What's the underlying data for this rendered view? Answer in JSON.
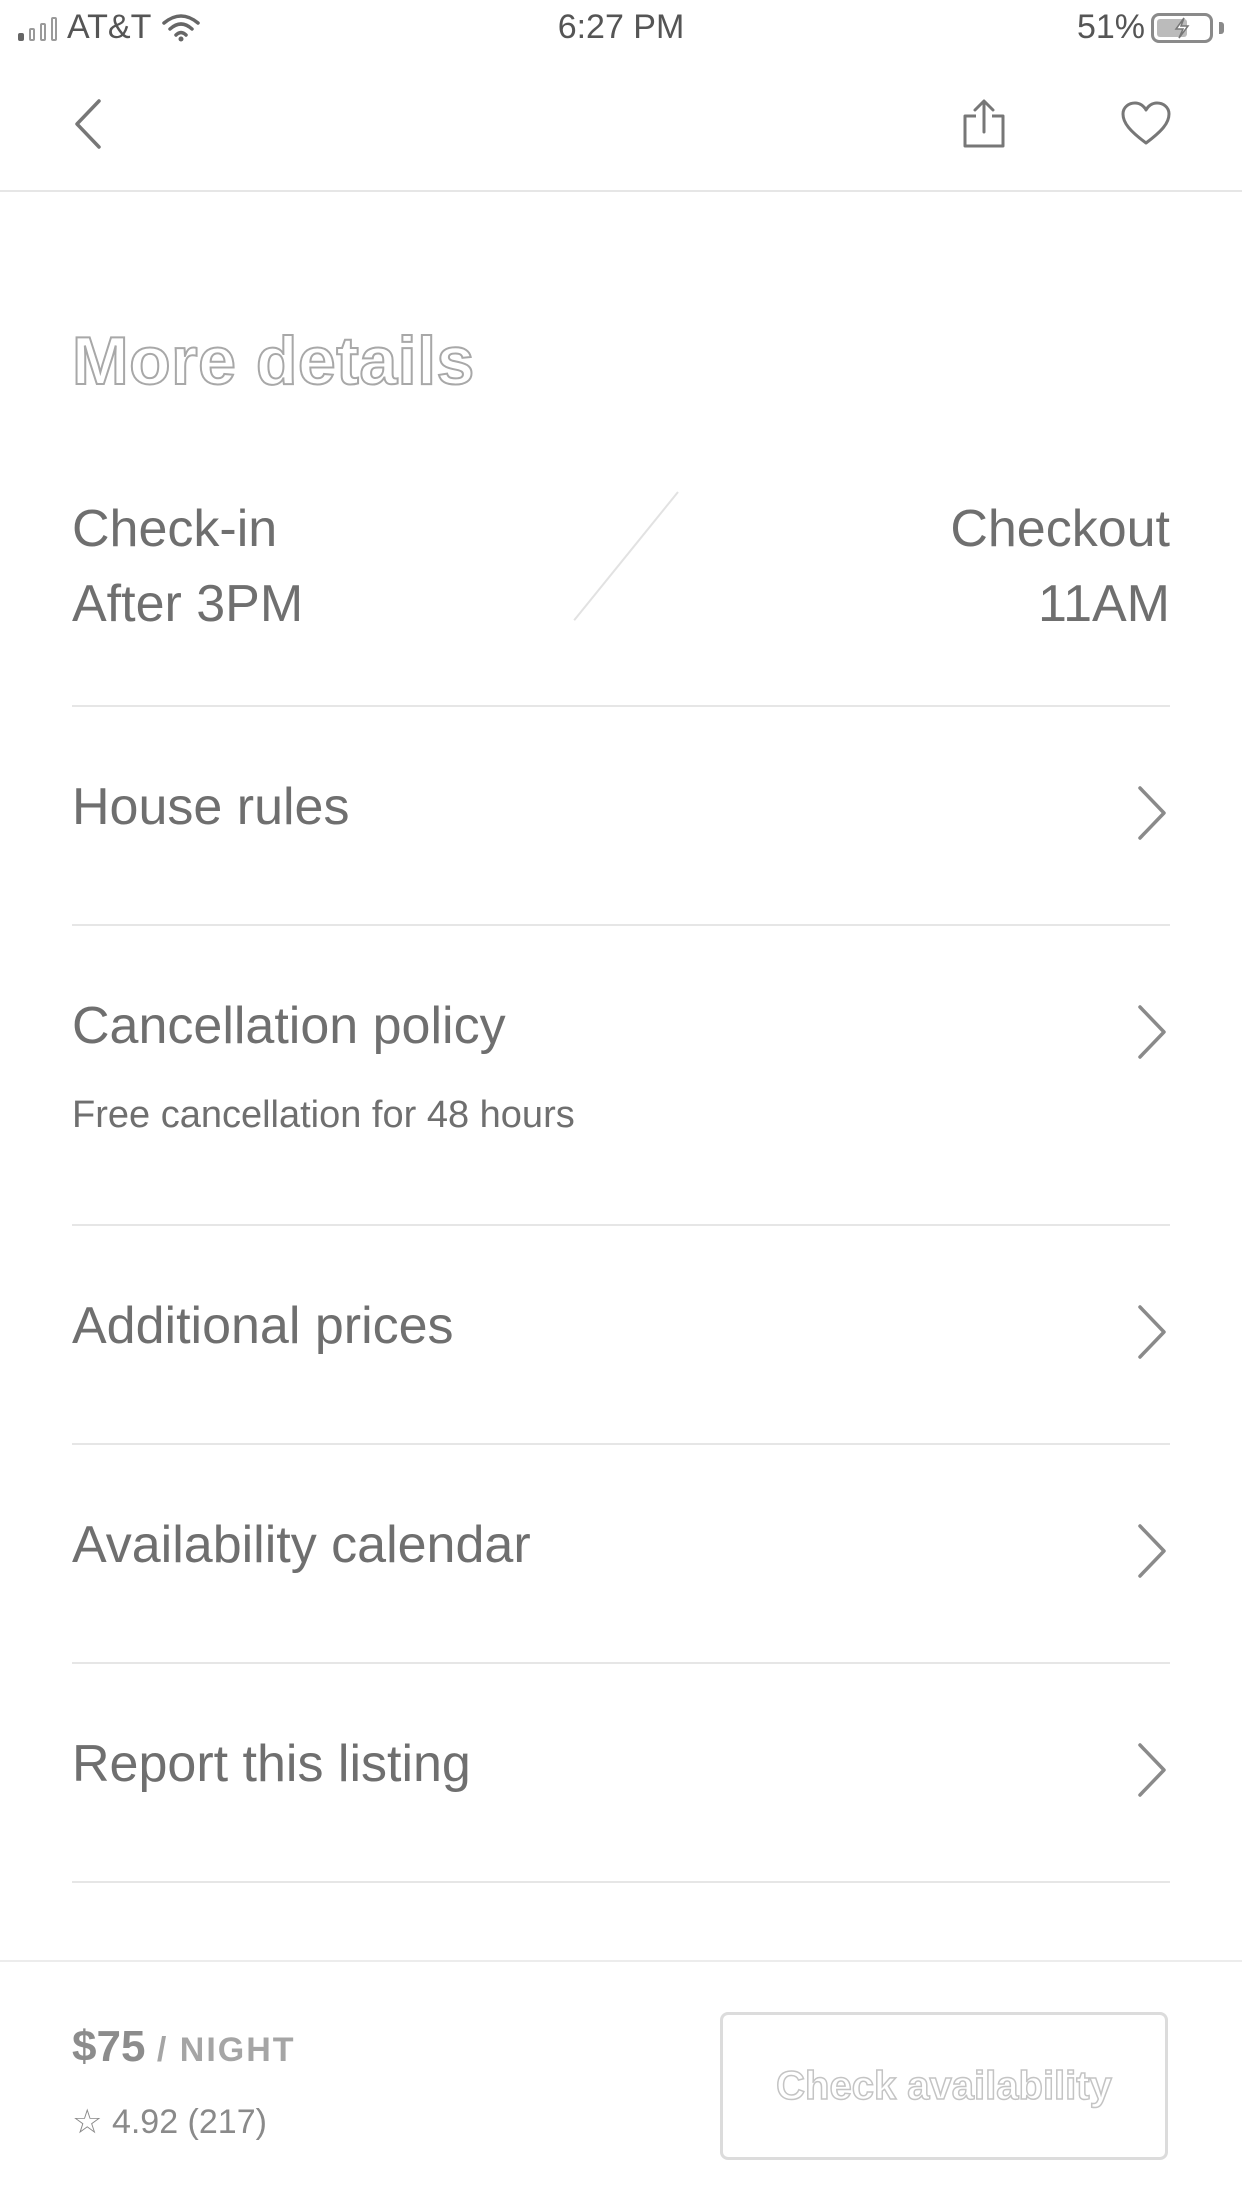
{
  "status_bar": {
    "carrier": "AT&T",
    "time": "6:27 PM",
    "battery_percent": "51%",
    "icons": [
      "signal-icon",
      "wifi-icon",
      "battery-charging-icon"
    ]
  },
  "nav": {
    "icons": [
      "chevron-left-icon",
      "share-icon",
      "heart-icon"
    ]
  },
  "page": {
    "title": "More details"
  },
  "checkin": {
    "label": "Check-in",
    "value": "After 3PM"
  },
  "checkout": {
    "label": "Checkout",
    "value": "11AM"
  },
  "rows": [
    {
      "label": "House rules"
    },
    {
      "label": "Cancellation policy",
      "subtitle": "Free cancellation for 48 hours"
    },
    {
      "label": "Additional prices"
    },
    {
      "label": "Availability calendar"
    },
    {
      "label": "Report this listing"
    }
  ],
  "booking": {
    "price": "$75",
    "unit": " / NIGHT",
    "rating_star": "☆",
    "rating": "4.92 (217)",
    "button_label": "Check availability"
  },
  "colors": {
    "text": "#6f6f6f",
    "divider": "#e6e6e6",
    "background": "#ffffff"
  }
}
